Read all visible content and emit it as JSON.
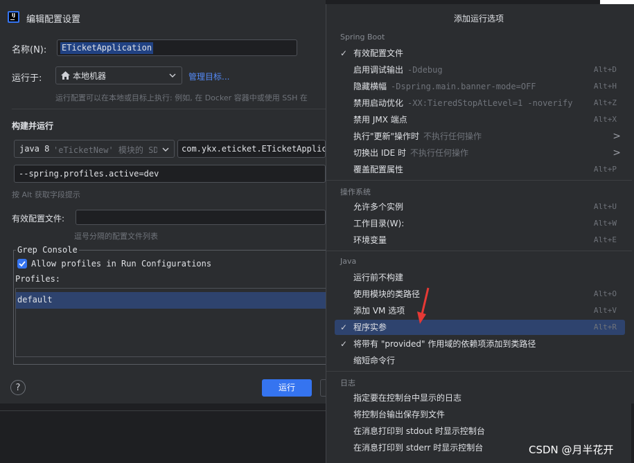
{
  "dialog": {
    "title": "编辑配置设置",
    "name_label": "名称(N):",
    "name_value": "ETicketApplication",
    "run_on_label": "运行于:",
    "run_on_value": "本地机器",
    "manage_targets": "管理目标...",
    "run_on_hint": "运行配置可以在本地或目标上执行: 例如, 在 Docker 容器中或使用 SSH 在",
    "build_run_title": "构建并运行",
    "jdk_value": "java 8",
    "jdk_module": "'eTicketNew' 模块的 SDK",
    "main_class": "com.ykx.eticket.ETicketApplicatio",
    "program_args": "--spring.profiles.active=dev",
    "alt_hint": "按 Alt 获取字段提示",
    "active_profiles_label": "有效配置文件:",
    "active_profiles_value": "",
    "active_profiles_hint": "逗号分隔的配置文件列表",
    "grep_console_title": "Grep Console",
    "allow_profiles_label": "Allow profiles in Run Configurations",
    "profiles_label": "Profiles:",
    "profiles_list": [
      "default"
    ],
    "help": "?",
    "run_button": "运行"
  },
  "popup": {
    "title": "添加运行选项",
    "groups": [
      {
        "header": "Spring Boot",
        "items": [
          {
            "check": "✓",
            "name": "有效配置文件",
            "extra": "",
            "shortcut": ""
          },
          {
            "check": "",
            "name": "启用调试输出",
            "extra": "-Ddebug",
            "shortcut": "Alt+D"
          },
          {
            "check": "",
            "name": "隐藏横幅",
            "extra": "-Dspring.main.banner-mode=OFF",
            "shortcut": "Alt+H"
          },
          {
            "check": "",
            "name": "禁用启动优化",
            "extra": "-XX:TieredStopAtLevel=1 -noverify",
            "shortcut": "Alt+Z"
          },
          {
            "check": "",
            "name": "禁用 JMX 端点",
            "extra": "",
            "shortcut": "Alt+X"
          },
          {
            "check": "",
            "name": "执行\"更新\"操作时",
            "extra": "不执行任何操作",
            "shortcut": ">"
          },
          {
            "check": "",
            "name": "切换出 IDE 时",
            "extra": "不执行任何操作",
            "shortcut": ">"
          },
          {
            "check": "",
            "name": "覆盖配置属性",
            "extra": "",
            "shortcut": "Alt+P"
          }
        ]
      },
      {
        "header": "操作系统",
        "items": [
          {
            "check": "",
            "name": "允许多个实例",
            "extra": "",
            "shortcut": "Alt+U"
          },
          {
            "check": "",
            "name": "工作目录(W):",
            "extra": "",
            "shortcut": "Alt+W"
          },
          {
            "check": "",
            "name": "环境变量",
            "extra": "",
            "shortcut": "Alt+E"
          }
        ]
      },
      {
        "header": "Java",
        "items": [
          {
            "check": "",
            "name": "运行前不构建",
            "extra": "",
            "shortcut": ""
          },
          {
            "check": "",
            "name": "使用模块的类路径",
            "extra": "",
            "shortcut": "Alt+O"
          },
          {
            "check": "",
            "name": "添加 VM 选项",
            "extra": "",
            "shortcut": "Alt+V"
          },
          {
            "check": "✓",
            "name": "程序实参",
            "extra": "",
            "shortcut": "Alt+R",
            "selected": true
          },
          {
            "check": "✓",
            "name": "将带有 \"provided\" 作用域的依赖项添加到类路径",
            "extra": "",
            "shortcut": ""
          },
          {
            "check": "",
            "name": "缩短命令行",
            "extra": "",
            "shortcut": ""
          }
        ]
      },
      {
        "header": "日志",
        "items": [
          {
            "check": "",
            "name": "指定要在控制台中显示的日志",
            "extra": "",
            "shortcut": ""
          },
          {
            "check": "",
            "name": "将控制台输出保存到文件",
            "extra": "",
            "shortcut": ""
          },
          {
            "check": "",
            "name": "在消息打印到 stdout 时显示控制台",
            "extra": "",
            "shortcut": ""
          },
          {
            "check": "",
            "name": "在消息打印到 stderr 时显示控制台",
            "extra": "",
            "shortcut": ""
          }
        ]
      }
    ]
  },
  "watermark": "CSDN @月半花开",
  "colors": {
    "accent": "#3574f0",
    "selection": "#2e436e",
    "background": "#2b2d30",
    "arrow": "#e53935"
  }
}
